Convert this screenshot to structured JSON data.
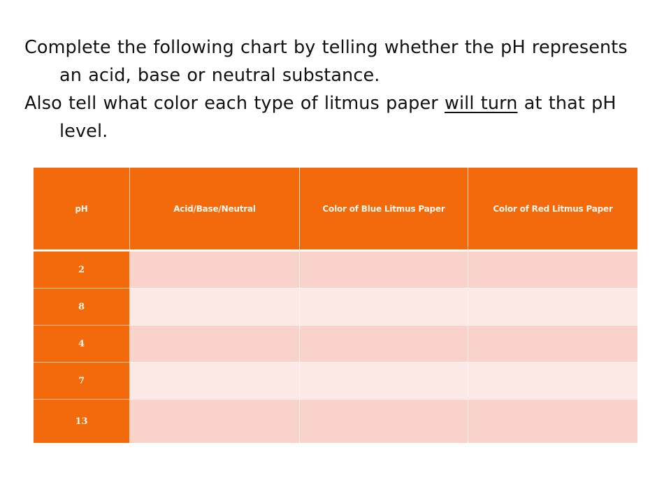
{
  "instructions": [
    {
      "before": "Complete the following chart by telling whether the pH represents an acid, base or neutral substance.",
      "underlined": "",
      "after": ""
    },
    {
      "before": "Also tell what color each type of litmus paper ",
      "underlined": "will turn",
      "after": " at that pH level."
    }
  ],
  "table": {
    "headers": [
      "pH",
      "Acid/Base/Neutral",
      "Color of Blue Litmus Paper",
      "Color of Red Litmus Paper"
    ],
    "rows": [
      {
        "ph": "2",
        "acid_base_neutral": "",
        "blue_litmus": "",
        "red_litmus": ""
      },
      {
        "ph": "8",
        "acid_base_neutral": "",
        "blue_litmus": "",
        "red_litmus": ""
      },
      {
        "ph": "4",
        "acid_base_neutral": "",
        "blue_litmus": "",
        "red_litmus": ""
      },
      {
        "ph": "7",
        "acid_base_neutral": "",
        "blue_litmus": "",
        "red_litmus": ""
      },
      {
        "ph": "13",
        "acid_base_neutral": "",
        "blue_litmus": "",
        "red_litmus": ""
      }
    ]
  },
  "colors": {
    "header_orange": "#F26A0C",
    "header_text": "#FFF4E6",
    "row_dark": "#F9D3CB",
    "row_light": "#FCE9E6"
  }
}
